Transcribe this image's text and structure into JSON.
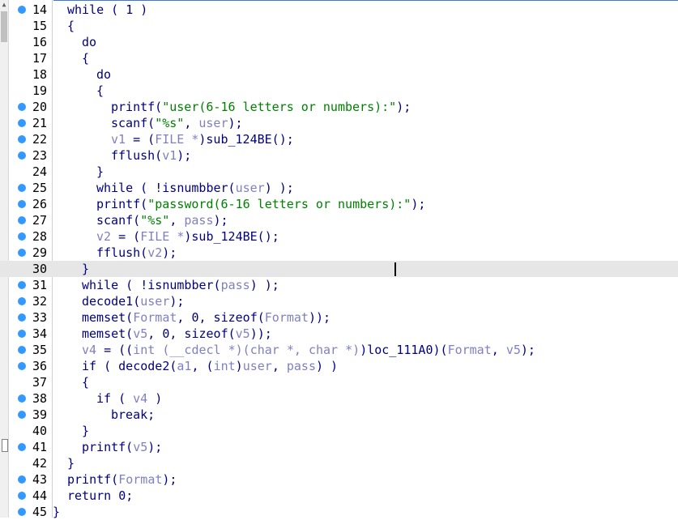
{
  "lines": [
    {
      "n": "14",
      "dot": true,
      "indent": 0,
      "parts": [
        {
          "t": "while ( 1 )"
        }
      ]
    },
    {
      "n": "15",
      "dot": false,
      "indent": 0,
      "parts": [
        {
          "t": "{"
        }
      ]
    },
    {
      "n": "16",
      "dot": false,
      "indent": 1,
      "parts": [
        {
          "t": "do"
        }
      ]
    },
    {
      "n": "17",
      "dot": false,
      "indent": 1,
      "parts": [
        {
          "t": "{"
        }
      ]
    },
    {
      "n": "18",
      "dot": false,
      "indent": 2,
      "parts": [
        {
          "t": "do"
        }
      ]
    },
    {
      "n": "19",
      "dot": false,
      "indent": 2,
      "parts": [
        {
          "t": "{"
        }
      ]
    },
    {
      "n": "20",
      "dot": true,
      "indent": 3,
      "parts": [
        {
          "t": "printf("
        },
        {
          "t": "\"user(6-16 letters or numbers):\"",
          "c": "s"
        },
        {
          "t": ");"
        }
      ]
    },
    {
      "n": "21",
      "dot": true,
      "indent": 3,
      "parts": [
        {
          "t": "scanf("
        },
        {
          "t": "\"%s\"",
          "c": "s"
        },
        {
          "t": ", "
        },
        {
          "t": "user",
          "c": "v"
        },
        {
          "t": ");"
        }
      ]
    },
    {
      "n": "22",
      "dot": true,
      "indent": 3,
      "parts": [
        {
          "t": "v1",
          "c": "v"
        },
        {
          "t": " = ("
        },
        {
          "t": "FILE *",
          "c": "v"
        },
        {
          "t": ")sub_124BE();"
        }
      ]
    },
    {
      "n": "23",
      "dot": true,
      "indent": 3,
      "parts": [
        {
          "t": "fflush("
        },
        {
          "t": "v1",
          "c": "v"
        },
        {
          "t": ");"
        }
      ]
    },
    {
      "n": "24",
      "dot": false,
      "indent": 2,
      "parts": [
        {
          "t": "}"
        }
      ]
    },
    {
      "n": "25",
      "dot": true,
      "indent": 2,
      "parts": [
        {
          "t": "while ( !isnumbber("
        },
        {
          "t": "user",
          "c": "v"
        },
        {
          "t": ") );"
        }
      ]
    },
    {
      "n": "26",
      "dot": true,
      "indent": 2,
      "parts": [
        {
          "t": "printf("
        },
        {
          "t": "\"password(6-16 letters or numbers):\"",
          "c": "s"
        },
        {
          "t": ");"
        }
      ]
    },
    {
      "n": "27",
      "dot": true,
      "indent": 2,
      "parts": [
        {
          "t": "scanf("
        },
        {
          "t": "\"%s\"",
          "c": "s"
        },
        {
          "t": ", "
        },
        {
          "t": "pass",
          "c": "v"
        },
        {
          "t": ");"
        }
      ]
    },
    {
      "n": "28",
      "dot": true,
      "indent": 2,
      "parts": [
        {
          "t": "v2",
          "c": "v"
        },
        {
          "t": " = ("
        },
        {
          "t": "FILE *",
          "c": "v"
        },
        {
          "t": ")sub_124BE();"
        }
      ]
    },
    {
      "n": "29",
      "dot": true,
      "indent": 2,
      "parts": [
        {
          "t": "fflush("
        },
        {
          "t": "v2",
          "c": "v"
        },
        {
          "t": ");"
        }
      ]
    },
    {
      "n": "30",
      "dot": false,
      "indent": 1,
      "hl": true,
      "parts": [
        {
          "t": "}"
        }
      ]
    },
    {
      "n": "31",
      "dot": true,
      "indent": 1,
      "parts": [
        {
          "t": "while ( !isnumbber("
        },
        {
          "t": "pass",
          "c": "v"
        },
        {
          "t": ") );"
        }
      ]
    },
    {
      "n": "32",
      "dot": true,
      "indent": 1,
      "parts": [
        {
          "t": "decode1("
        },
        {
          "t": "user",
          "c": "v"
        },
        {
          "t": ");"
        }
      ]
    },
    {
      "n": "33",
      "dot": true,
      "indent": 1,
      "parts": [
        {
          "t": "memset("
        },
        {
          "t": "Format",
          "c": "v"
        },
        {
          "t": ", 0, sizeof("
        },
        {
          "t": "Format",
          "c": "v"
        },
        {
          "t": "));"
        }
      ]
    },
    {
      "n": "34",
      "dot": true,
      "indent": 1,
      "parts": [
        {
          "t": "memset("
        },
        {
          "t": "v5",
          "c": "v"
        },
        {
          "t": ", 0, sizeof("
        },
        {
          "t": "v5",
          "c": "v"
        },
        {
          "t": "));"
        }
      ]
    },
    {
      "n": "35",
      "dot": true,
      "indent": 1,
      "parts": [
        {
          "t": "v4",
          "c": "v"
        },
        {
          "t": " = (("
        },
        {
          "t": "int (__cdecl *)(char *, char *)",
          "c": "v"
        },
        {
          "t": ")loc_111A0)("
        },
        {
          "t": "Format",
          "c": "v"
        },
        {
          "t": ", "
        },
        {
          "t": "v5",
          "c": "v"
        },
        {
          "t": ");"
        }
      ]
    },
    {
      "n": "36",
      "dot": true,
      "indent": 1,
      "parts": [
        {
          "t": "if ( decode2("
        },
        {
          "t": "a1",
          "c": "v"
        },
        {
          "t": ", ("
        },
        {
          "t": "int",
          "c": "v"
        },
        {
          "t": ")"
        },
        {
          "t": "user",
          "c": "v"
        },
        {
          "t": ", "
        },
        {
          "t": "pass",
          "c": "v"
        },
        {
          "t": ") )"
        }
      ]
    },
    {
      "n": "37",
      "dot": false,
      "indent": 1,
      "parts": [
        {
          "t": "{"
        }
      ]
    },
    {
      "n": "38",
      "dot": true,
      "indent": 2,
      "parts": [
        {
          "t": "if ( "
        },
        {
          "t": "v4",
          "c": "v"
        },
        {
          "t": " )"
        }
      ]
    },
    {
      "n": "39",
      "dot": true,
      "indent": 3,
      "parts": [
        {
          "t": "break;"
        }
      ]
    },
    {
      "n": "40",
      "dot": false,
      "indent": 1,
      "parts": [
        {
          "t": "}"
        }
      ]
    },
    {
      "n": "41",
      "dot": true,
      "indent": 1,
      "parts": [
        {
          "t": "printf("
        },
        {
          "t": "v5",
          "c": "v"
        },
        {
          "t": ");"
        }
      ]
    },
    {
      "n": "42",
      "dot": false,
      "indent": 0,
      "parts": [
        {
          "t": "}"
        }
      ]
    },
    {
      "n": "43",
      "dot": true,
      "indent": 0,
      "parts": [
        {
          "t": "printf("
        },
        {
          "t": "Format",
          "c": "v"
        },
        {
          "t": ");"
        }
      ]
    },
    {
      "n": "44",
      "dot": true,
      "indent": 0,
      "parts": [
        {
          "t": "return 0;"
        }
      ]
    },
    {
      "n": "45",
      "dot": true,
      "indent": -1,
      "parts": [
        {
          "t": "}"
        }
      ]
    }
  ],
  "colors": {
    "keyword": "#000080",
    "string": "#008000",
    "variable": "#8080c0",
    "breakpoint": "#3399ff",
    "highlight": "#e6e6e6"
  }
}
